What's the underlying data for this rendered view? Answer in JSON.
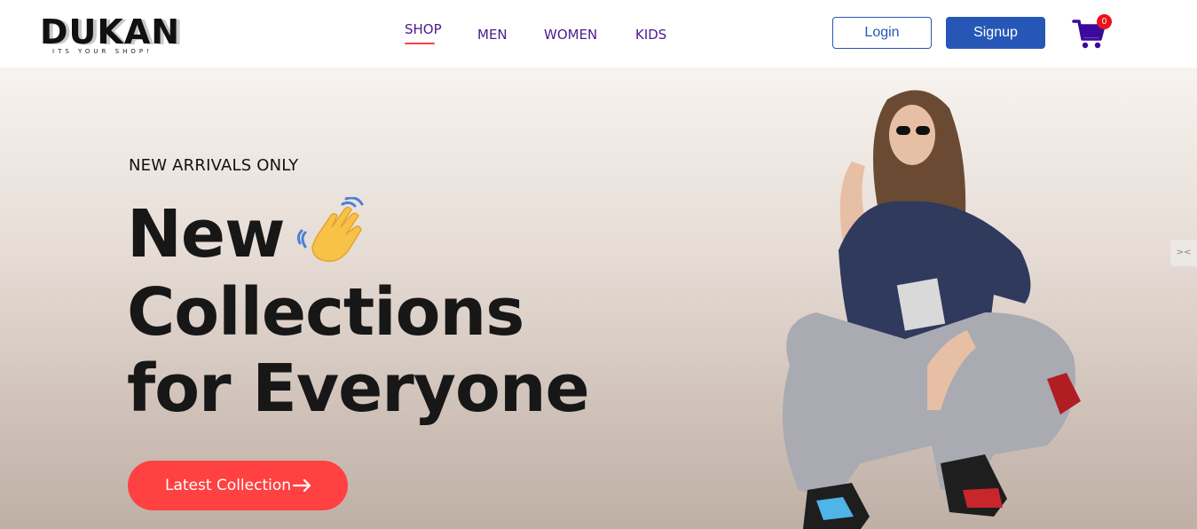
{
  "brand": {
    "name": "DUKAN",
    "tagline": "ITS YOUR SHOP!"
  },
  "nav": {
    "items": [
      {
        "label": "SHOP",
        "active": true
      },
      {
        "label": "MEN",
        "active": false
      },
      {
        "label": "WOMEN",
        "active": false
      },
      {
        "label": "KIDS",
        "active": false
      }
    ]
  },
  "auth": {
    "login_label": "Login",
    "signup_label": "Signup"
  },
  "cart": {
    "icon": "shopping-cart-icon",
    "count": "0"
  },
  "hero": {
    "eyebrow": "NEW ARRIVALS ONLY",
    "headline": [
      "New",
      "Collections",
      "for Everyone"
    ],
    "emoji": "waving-hand-icon",
    "cta_label": "Latest Collection",
    "cta_icon": "arrow-right-icon"
  },
  "side_widget": {
    "icon": "close-icon",
    "label": "><"
  },
  "colors": {
    "accent": "#ff4141",
    "brand_blue": "#2657b6",
    "nav_purple": "#4b1b8a",
    "cart_purple": "#3b0a9a",
    "hero_top": "#f7f3ef",
    "hero_bottom": "#bfb0a6"
  }
}
